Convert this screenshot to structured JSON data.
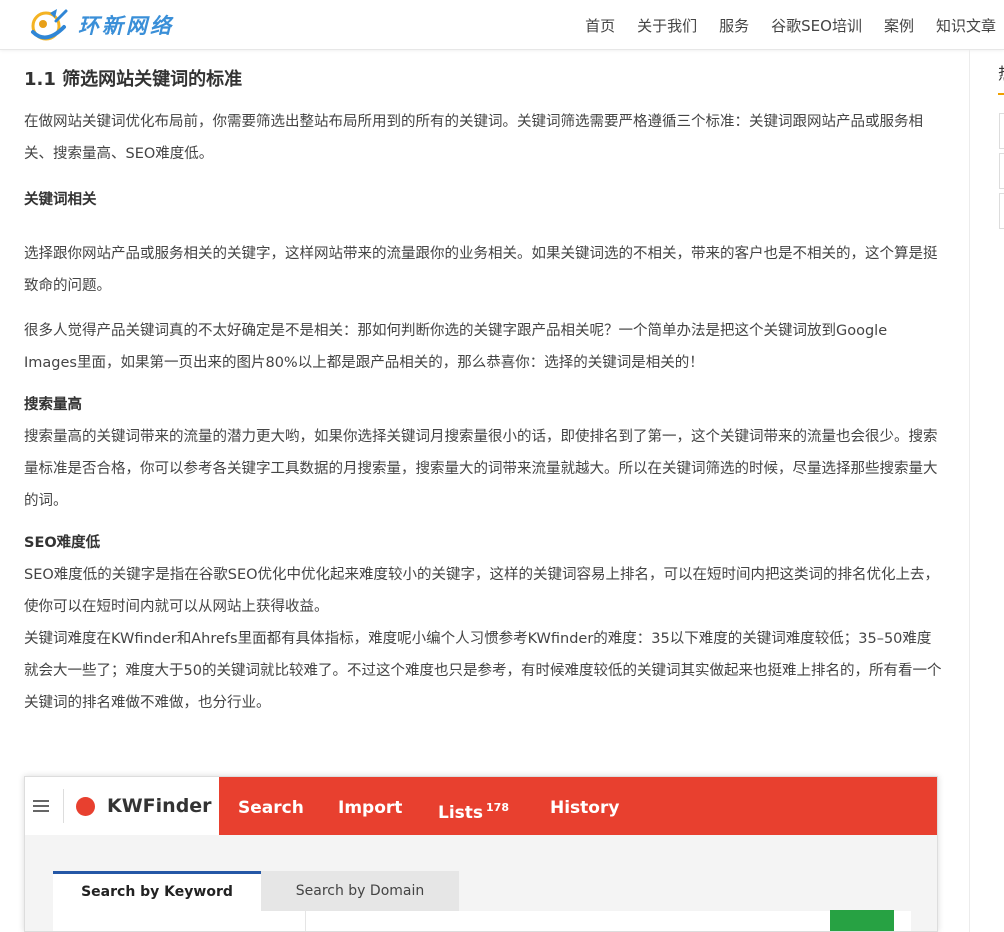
{
  "site": {
    "logo_text": "环新网络"
  },
  "nav": {
    "items": [
      {
        "label": "首页"
      },
      {
        "label": "关于我们"
      },
      {
        "label": "服务"
      },
      {
        "label": "谷歌SEO培训"
      },
      {
        "label": "案例"
      },
      {
        "label": "知识文章"
      }
    ]
  },
  "sidebar": {
    "tab_partial": "热"
  },
  "article": {
    "section_title": "1.1 筛选网站关键词的标准",
    "intro": "在做网站关键词优化布局前，你需要筛选出整站布局所用到的所有的关键词。关键词筛选需要严格遵循三个标准：关键词跟网站产品或服务相关、搜索量高、SEO难度低。",
    "h_relevance": "关键词相关",
    "p_relevance_1": "选择跟你网站产品或服务相关的关键字，这样网站带来的流量跟你的业务相关。如果关键词选的不相关，带来的客户也是不相关的，这个算是挺致命的问题。",
    "p_relevance_2": "很多人觉得产品关键词真的不太好确定是不是相关：那如何判断你选的关键字跟产品相关呢？一个简单办法是把这个关键词放到Google Images里面，如果第一页出来的图片80%以上都是跟产品相关的，那么恭喜你：选择的关键词是相关的！",
    "h_volume": "搜索量高",
    "p_volume": "搜索量高的关键词带来的流量的潜力更大哟，如果你选择关键词月搜索量很小的话，即使排名到了第一，这个关键词带来的流量也会很少。搜索量标准是否合格，你可以参考各关键字工具数据的月搜索量，搜索量大的词带来流量就越大。所以在关键词筛选的时候，尽量选择那些搜索量大的词。",
    "h_difficulty": "SEO难度低",
    "p_difficulty_1": "SEO难度低的关键字是指在谷歌SEO优化中优化起来难度较小的关键字，这样的关键词容易上排名，可以在短时间内把这类词的排名优化上去，使你可以在短时间内就可以从网站上获得收益。",
    "p_difficulty_2": "关键词难度在KWfinder和Ahrefs里面都有具体指标，难度呢小编个人习惯参考KWfinder的难度：35以下难度的关键词难度较低；35–50难度就会大一些了；难度大于50的关键词就比较难了。不过这个难度也只是参考，有时候难度较低的关键词其实做起来也挺难上排名的，所有看一个关键词的排名难做不难做，也分行业。"
  },
  "kwfinder": {
    "brand": "KWFinder",
    "tabs": {
      "search": "Search",
      "import": "Import",
      "lists": "Lists",
      "lists_count": "178",
      "history": "History"
    },
    "panel_tabs": {
      "keyword": "Search by Keyword",
      "domain": "Search by Domain"
    }
  },
  "colors": {
    "kw_red": "#e8402f",
    "kw_blue": "#2457a6",
    "kw_green": "#27a243",
    "logo_blue": "#3a8fd8"
  }
}
